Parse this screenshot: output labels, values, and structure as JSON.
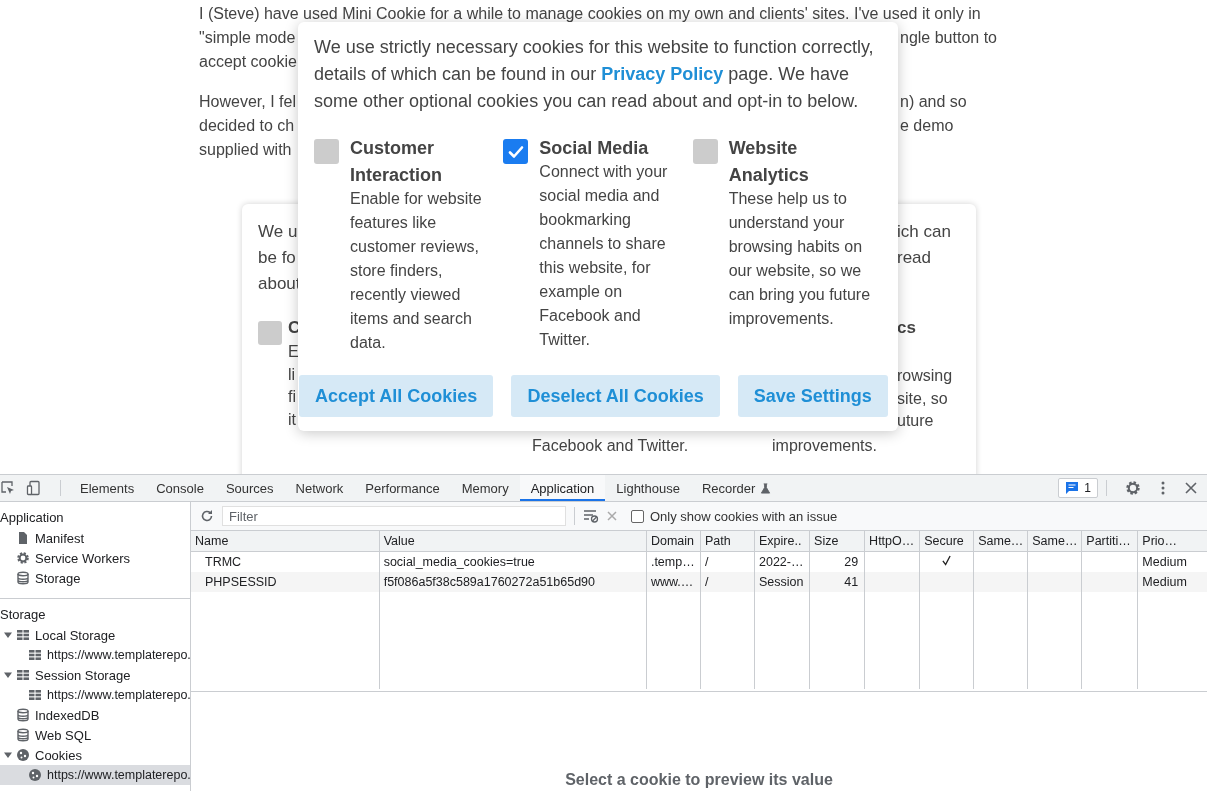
{
  "article": {
    "paragraphs": [
      {
        "lines": [
          {
            "left": "I (Steve) have used Mini Cookie for a while to manage cookies on my own and clients' sites. I've used it only in"
          },
          {
            "left": "\"simple mode",
            "right": "ngle button to"
          },
          {
            "left": "accept cookie"
          }
        ]
      },
      {
        "lines": [
          {
            "left": "However, I fel",
            "right": "n) and so"
          },
          {
            "left": "decided to ch",
            "right": "e demo"
          },
          {
            "left": "supplied with"
          }
        ]
      }
    ]
  },
  "background_banner": {
    "left_lines": [
      "We u",
      "be fo",
      "about"
    ],
    "right_lines": [
      "ich can",
      "read"
    ],
    "checkbox_checked": false,
    "left_option": {
      "title": "C",
      "lines": [
        "E",
        "li",
        "fi",
        "it"
      ]
    },
    "right_option": {
      "title": "cs",
      "lines": [
        "rowsing",
        "site, so",
        "uture"
      ]
    },
    "bottom_lines": [
      "Facebook and Twitter.",
      "improvements."
    ]
  },
  "cookie_banner": {
    "intro_before": "We use strictly necessary cookies for this website to function correctly, details of which can be found in our",
    "link": "Privacy Policy",
    "intro_after": "page. We have some other optional cookies you can read about and opt-in to below.",
    "options": [
      {
        "title": "Customer Interaction",
        "description": "Enable for website features like customer reviews, store finders, recently viewed items and search data.",
        "checked": false
      },
      {
        "title": "Social Media",
        "description": "Connect with your social media and bookmarking channels to share this website, for example on Facebook and Twitter.",
        "checked": true
      },
      {
        "title": "Website Analytics",
        "description": "These help us to understand your browsing habits on our website, so we can bring you future improvements.",
        "checked": false
      }
    ],
    "buttons": [
      "Accept All Cookies",
      "Deselect All Cookies",
      "Save Settings"
    ]
  },
  "devtools": {
    "tabs": [
      {
        "label": "Elements",
        "selected": false
      },
      {
        "label": "Console",
        "selected": false
      },
      {
        "label": "Sources",
        "selected": false
      },
      {
        "label": "Network",
        "selected": false
      },
      {
        "label": "Performance",
        "selected": false
      },
      {
        "label": "Memory",
        "selected": false
      },
      {
        "label": "Application",
        "selected": true
      },
      {
        "label": "Lighthouse",
        "selected": false
      },
      {
        "label": "Recorder",
        "selected": false
      }
    ],
    "issues_count": "1",
    "sidebar": [
      {
        "heading": "Application",
        "items": [
          {
            "label": "Manifest",
            "kind": "file",
            "selected": false
          },
          {
            "label": "Service Workers",
            "kind": "gear",
            "selected": false
          },
          {
            "label": "Storage",
            "kind": "database",
            "selected": false
          }
        ]
      },
      {
        "heading": "Storage",
        "items": [
          {
            "label": "Local Storage",
            "kind": "grid",
            "selected": false,
            "expanded": true,
            "children": [
              {
                "label": "https://www.templaterepo.",
                "kind": "grid",
                "selected": false
              }
            ]
          },
          {
            "label": "Session Storage",
            "kind": "grid",
            "selected": false,
            "expanded": true,
            "children": [
              {
                "label": "https://www.templaterepo.",
                "kind": "grid",
                "selected": false
              }
            ]
          },
          {
            "label": "IndexedDB",
            "kind": "database",
            "selected": false
          },
          {
            "label": "Web SQL",
            "kind": "database",
            "selected": false
          },
          {
            "label": "Cookies",
            "kind": "cookie",
            "selected": false,
            "expanded": true,
            "children": [
              {
                "label": "https://www.templaterepo.",
                "kind": "cookie",
                "selected": true
              }
            ]
          }
        ]
      }
    ],
    "filter": {
      "placeholder": "Filter",
      "only_issues_label": "Only show cookies with an issue",
      "only_issues_checked": false
    },
    "columns": [
      "Name",
      "Value",
      "Domain",
      "Path",
      "Expire..",
      "Size",
      "HttpO…",
      "Secure",
      "Same…",
      "Same…",
      "Partiti…",
      "Prio…"
    ],
    "rows": [
      {
        "name": "TRMC",
        "value": "social_media_cookies=true",
        "domain": ".temp…",
        "path": "/",
        "expires": "2022-…",
        "size": "29",
        "secure": true,
        "priority": "Medium"
      },
      {
        "name": "PHPSESSID",
        "value": "f5f086a5f38c589a1760272a51b65d90",
        "domain": "www.…",
        "path": "/",
        "expires": "Session",
        "size": "41",
        "secure": false,
        "priority": "Medium"
      }
    ],
    "preview_hint": "Select a cookie to preview its value"
  }
}
